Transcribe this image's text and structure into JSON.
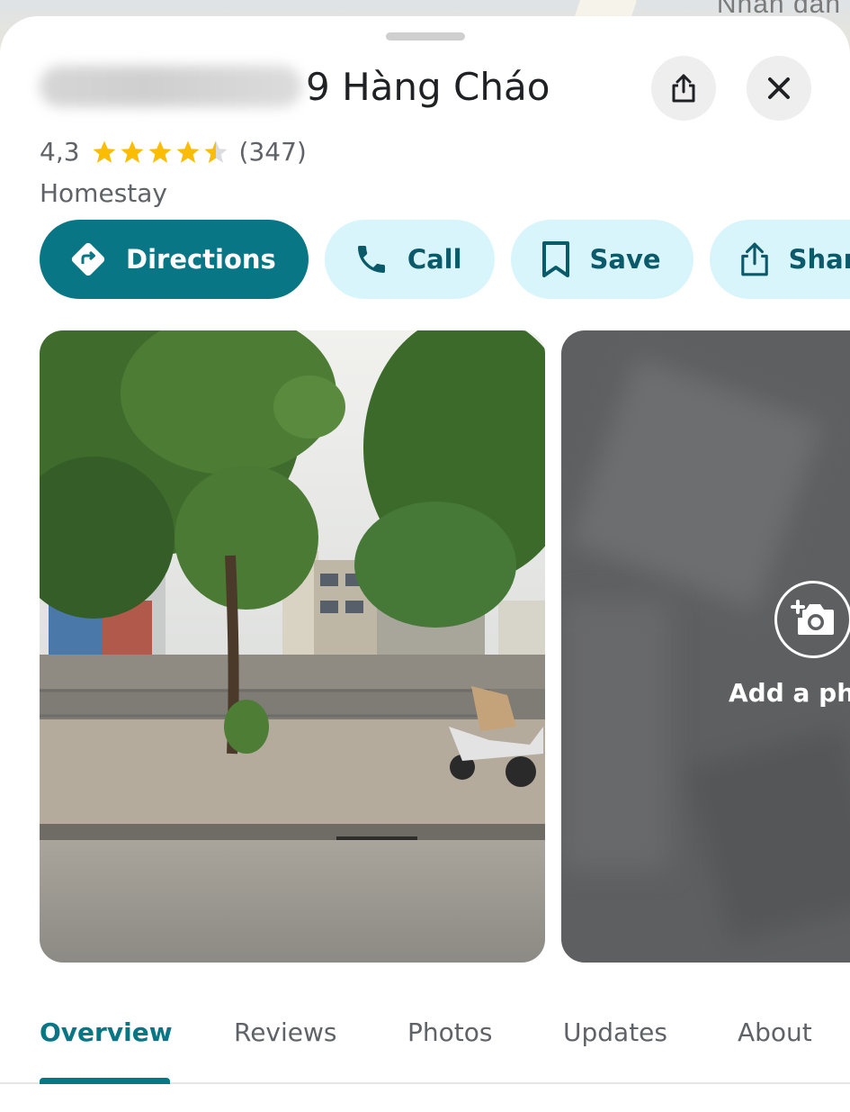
{
  "map": {
    "label": "Nhân dân"
  },
  "place": {
    "title_visible": "9 Hàng Cháo",
    "rating": "4,3",
    "stars": 4.3,
    "review_count": "(347)",
    "category": "Homestay"
  },
  "header_buttons": {
    "share_icon": "share-icon",
    "close_icon": "close-icon"
  },
  "actions": [
    {
      "label": "Directions",
      "icon": "directions-icon"
    },
    {
      "label": "Call",
      "icon": "phone-icon"
    },
    {
      "label": "Save",
      "icon": "bookmark-icon"
    },
    {
      "label": "Share",
      "icon": "share-icon"
    }
  ],
  "photos": {
    "add_photo_label": "Add a photo"
  },
  "tabs": [
    {
      "label": "Overview",
      "active": true
    },
    {
      "label": "Reviews",
      "active": false
    },
    {
      "label": "Photos",
      "active": false
    },
    {
      "label": "Updates",
      "active": false
    },
    {
      "label": "About",
      "active": false
    }
  ],
  "colors": {
    "accent": "#087685",
    "chip_bg": "#d9f5fc",
    "chip_text": "#0b5a69",
    "star": "#fbbc04"
  }
}
